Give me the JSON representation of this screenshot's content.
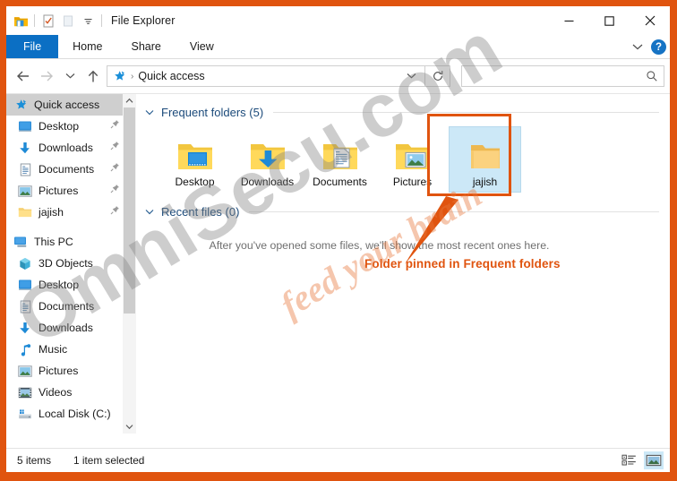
{
  "window": {
    "title": "File Explorer",
    "quick_access_toolbar": [
      {
        "name": "folder-icon",
        "label": "File Explorer"
      },
      {
        "name": "properties-icon",
        "label": "Properties"
      },
      {
        "name": "new-folder-icon",
        "label": "New folder"
      },
      {
        "name": "customize-qat-chevron-icon",
        "label": "Customize Quick Access Toolbar"
      }
    ],
    "caption_buttons": [
      {
        "name": "minimize-button",
        "glyph": "—"
      },
      {
        "name": "maximize-button",
        "glyph": "□"
      },
      {
        "name": "close-button",
        "glyph": "×"
      }
    ]
  },
  "ribbon": {
    "tabs": [
      {
        "label": "File",
        "active": true
      },
      {
        "label": "Home",
        "active": false
      },
      {
        "label": "Share",
        "active": false
      },
      {
        "label": "View",
        "active": false
      }
    ],
    "collapse_label": "Minimize the Ribbon",
    "help_label": "?"
  },
  "address": {
    "back_label": "Back",
    "forward_label": "Forward",
    "recent_label": "Recent locations",
    "up_label": "Up",
    "breadcrumb": "Quick access",
    "breadcrumb_separator": "›",
    "dropdown_label": "Previous locations",
    "refresh_label": "Refresh",
    "search_value": "",
    "search_placeholder": ""
  },
  "sidebar": {
    "quick_access": {
      "label": "Quick access",
      "icon": "star-icon",
      "selected": true
    },
    "quick_access_items": [
      {
        "label": "Desktop",
        "icon": "desktop-icon",
        "pinned": true
      },
      {
        "label": "Downloads",
        "icon": "downloads-icon",
        "pinned": true
      },
      {
        "label": "Documents",
        "icon": "documents-icon",
        "pinned": true
      },
      {
        "label": "Pictures",
        "icon": "pictures-icon",
        "pinned": true
      },
      {
        "label": "jajish",
        "icon": "folder-icon",
        "pinned": true
      }
    ],
    "this_pc": {
      "label": "This PC",
      "icon": "this-pc-icon"
    },
    "this_pc_items": [
      {
        "label": "3D Objects",
        "icon": "3d-objects-icon"
      },
      {
        "label": "Desktop",
        "icon": "desktop-icon"
      },
      {
        "label": "Documents",
        "icon": "documents-icon"
      },
      {
        "label": "Downloads",
        "icon": "downloads-icon"
      },
      {
        "label": "Music",
        "icon": "music-icon"
      },
      {
        "label": "Pictures",
        "icon": "pictures-icon"
      },
      {
        "label": "Videos",
        "icon": "videos-icon"
      },
      {
        "label": "Local Disk (C:)",
        "icon": "disk-icon"
      }
    ]
  },
  "content": {
    "frequent_folders_title": "Frequent folders (5)",
    "recent_files_title": "Recent files (0)",
    "empty_message": "After you've opened some files, we'll show the most recent ones here.",
    "tiles": [
      {
        "label": "Desktop",
        "icon": "folder-desktop-icon",
        "selected": false
      },
      {
        "label": "Downloads",
        "icon": "folder-downloads-icon",
        "selected": false
      },
      {
        "label": "Documents",
        "icon": "folder-documents-icon",
        "selected": false
      },
      {
        "label": "Pictures",
        "icon": "folder-pictures-icon",
        "selected": false
      },
      {
        "label": "jajish",
        "icon": "folder-icon",
        "selected": true
      }
    ]
  },
  "annotation": {
    "text": "Folder pinned in Frequent folders",
    "color": "#e0540f"
  },
  "status": {
    "item_count": "5 items",
    "selection": "1 item selected",
    "view_buttons": [
      {
        "name": "details-view-button",
        "active": false
      },
      {
        "name": "large-icons-view-button",
        "active": true
      }
    ]
  },
  "watermark": {
    "main": "OmniSecu.com",
    "sub": "feed your brain"
  },
  "colors": {
    "accent_blue": "#0b6fc4",
    "selection_blue": "#cce8f7",
    "annotation_orange": "#e0540f",
    "group_header_blue": "#1b4a7a"
  }
}
